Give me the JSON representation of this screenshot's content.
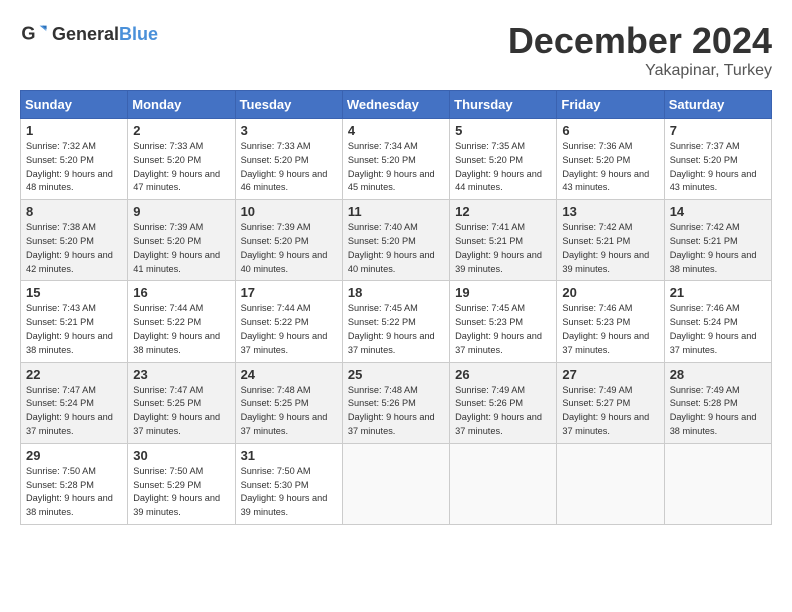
{
  "header": {
    "logo_general": "General",
    "logo_blue": "Blue",
    "month": "December 2024",
    "location": "Yakapinar, Turkey"
  },
  "weekdays": [
    "Sunday",
    "Monday",
    "Tuesday",
    "Wednesday",
    "Thursday",
    "Friday",
    "Saturday"
  ],
  "weeks": [
    [
      {
        "day": "1",
        "sunrise": "7:32 AM",
        "sunset": "5:20 PM",
        "daylight": "9 hours and 48 minutes."
      },
      {
        "day": "2",
        "sunrise": "7:33 AM",
        "sunset": "5:20 PM",
        "daylight": "9 hours and 47 minutes."
      },
      {
        "day": "3",
        "sunrise": "7:33 AM",
        "sunset": "5:20 PM",
        "daylight": "9 hours and 46 minutes."
      },
      {
        "day": "4",
        "sunrise": "7:34 AM",
        "sunset": "5:20 PM",
        "daylight": "9 hours and 45 minutes."
      },
      {
        "day": "5",
        "sunrise": "7:35 AM",
        "sunset": "5:20 PM",
        "daylight": "9 hours and 44 minutes."
      },
      {
        "day": "6",
        "sunrise": "7:36 AM",
        "sunset": "5:20 PM",
        "daylight": "9 hours and 43 minutes."
      },
      {
        "day": "7",
        "sunrise": "7:37 AM",
        "sunset": "5:20 PM",
        "daylight": "9 hours and 43 minutes."
      }
    ],
    [
      {
        "day": "8",
        "sunrise": "7:38 AM",
        "sunset": "5:20 PM",
        "daylight": "9 hours and 42 minutes."
      },
      {
        "day": "9",
        "sunrise": "7:39 AM",
        "sunset": "5:20 PM",
        "daylight": "9 hours and 41 minutes."
      },
      {
        "day": "10",
        "sunrise": "7:39 AM",
        "sunset": "5:20 PM",
        "daylight": "9 hours and 40 minutes."
      },
      {
        "day": "11",
        "sunrise": "7:40 AM",
        "sunset": "5:20 PM",
        "daylight": "9 hours and 40 minutes."
      },
      {
        "day": "12",
        "sunrise": "7:41 AM",
        "sunset": "5:21 PM",
        "daylight": "9 hours and 39 minutes."
      },
      {
        "day": "13",
        "sunrise": "7:42 AM",
        "sunset": "5:21 PM",
        "daylight": "9 hours and 39 minutes."
      },
      {
        "day": "14",
        "sunrise": "7:42 AM",
        "sunset": "5:21 PM",
        "daylight": "9 hours and 38 minutes."
      }
    ],
    [
      {
        "day": "15",
        "sunrise": "7:43 AM",
        "sunset": "5:21 PM",
        "daylight": "9 hours and 38 minutes."
      },
      {
        "day": "16",
        "sunrise": "7:44 AM",
        "sunset": "5:22 PM",
        "daylight": "9 hours and 38 minutes."
      },
      {
        "day": "17",
        "sunrise": "7:44 AM",
        "sunset": "5:22 PM",
        "daylight": "9 hours and 37 minutes."
      },
      {
        "day": "18",
        "sunrise": "7:45 AM",
        "sunset": "5:22 PM",
        "daylight": "9 hours and 37 minutes."
      },
      {
        "day": "19",
        "sunrise": "7:45 AM",
        "sunset": "5:23 PM",
        "daylight": "9 hours and 37 minutes."
      },
      {
        "day": "20",
        "sunrise": "7:46 AM",
        "sunset": "5:23 PM",
        "daylight": "9 hours and 37 minutes."
      },
      {
        "day": "21",
        "sunrise": "7:46 AM",
        "sunset": "5:24 PM",
        "daylight": "9 hours and 37 minutes."
      }
    ],
    [
      {
        "day": "22",
        "sunrise": "7:47 AM",
        "sunset": "5:24 PM",
        "daylight": "9 hours and 37 minutes."
      },
      {
        "day": "23",
        "sunrise": "7:47 AM",
        "sunset": "5:25 PM",
        "daylight": "9 hours and 37 minutes."
      },
      {
        "day": "24",
        "sunrise": "7:48 AM",
        "sunset": "5:25 PM",
        "daylight": "9 hours and 37 minutes."
      },
      {
        "day": "25",
        "sunrise": "7:48 AM",
        "sunset": "5:26 PM",
        "daylight": "9 hours and 37 minutes."
      },
      {
        "day": "26",
        "sunrise": "7:49 AM",
        "sunset": "5:26 PM",
        "daylight": "9 hours and 37 minutes."
      },
      {
        "day": "27",
        "sunrise": "7:49 AM",
        "sunset": "5:27 PM",
        "daylight": "9 hours and 37 minutes."
      },
      {
        "day": "28",
        "sunrise": "7:49 AM",
        "sunset": "5:28 PM",
        "daylight": "9 hours and 38 minutes."
      }
    ],
    [
      {
        "day": "29",
        "sunrise": "7:50 AM",
        "sunset": "5:28 PM",
        "daylight": "9 hours and 38 minutes."
      },
      {
        "day": "30",
        "sunrise": "7:50 AM",
        "sunset": "5:29 PM",
        "daylight": "9 hours and 39 minutes."
      },
      {
        "day": "31",
        "sunrise": "7:50 AM",
        "sunset": "5:30 PM",
        "daylight": "9 hours and 39 minutes."
      },
      null,
      null,
      null,
      null
    ]
  ]
}
